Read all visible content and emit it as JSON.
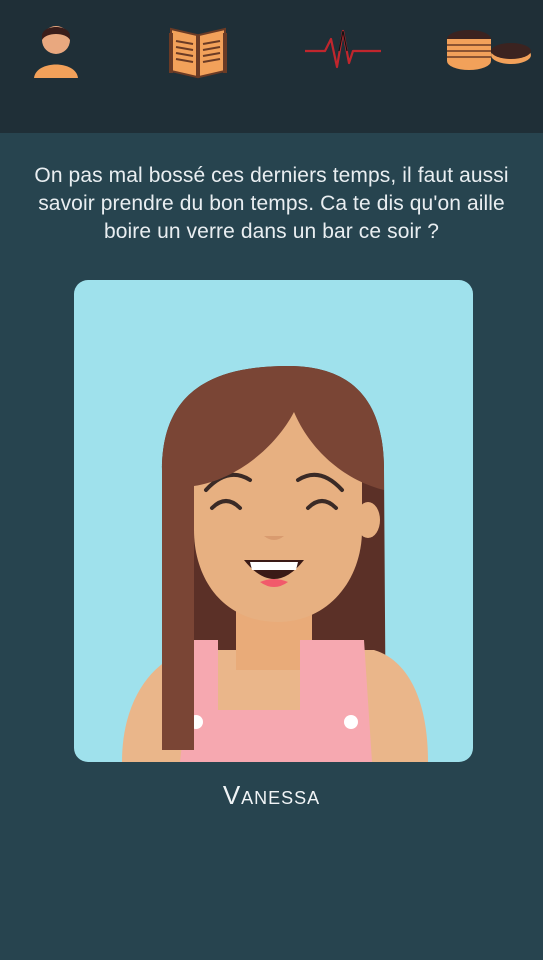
{
  "nav": {
    "items": [
      {
        "id": "profile",
        "icon": "person-icon"
      },
      {
        "id": "news",
        "icon": "newspaper-icon"
      },
      {
        "id": "health",
        "icon": "heartbeat-icon"
      },
      {
        "id": "money",
        "icon": "coins-icon"
      }
    ]
  },
  "dialog": {
    "message": "On pas mal bossé ces derniers temps, il faut aussi savoir prendre du bon temps. Ca te dis qu'on aille boire un verre dans un bar ce soir ?"
  },
  "character": {
    "name": "Vanessa"
  },
  "colors": {
    "background": "#27444f",
    "topbar": "#1f2f37",
    "portrait_bg": "#9fe1ec",
    "accent_orange": "#f2a15a",
    "heartbeat_red": "#c0262d"
  }
}
